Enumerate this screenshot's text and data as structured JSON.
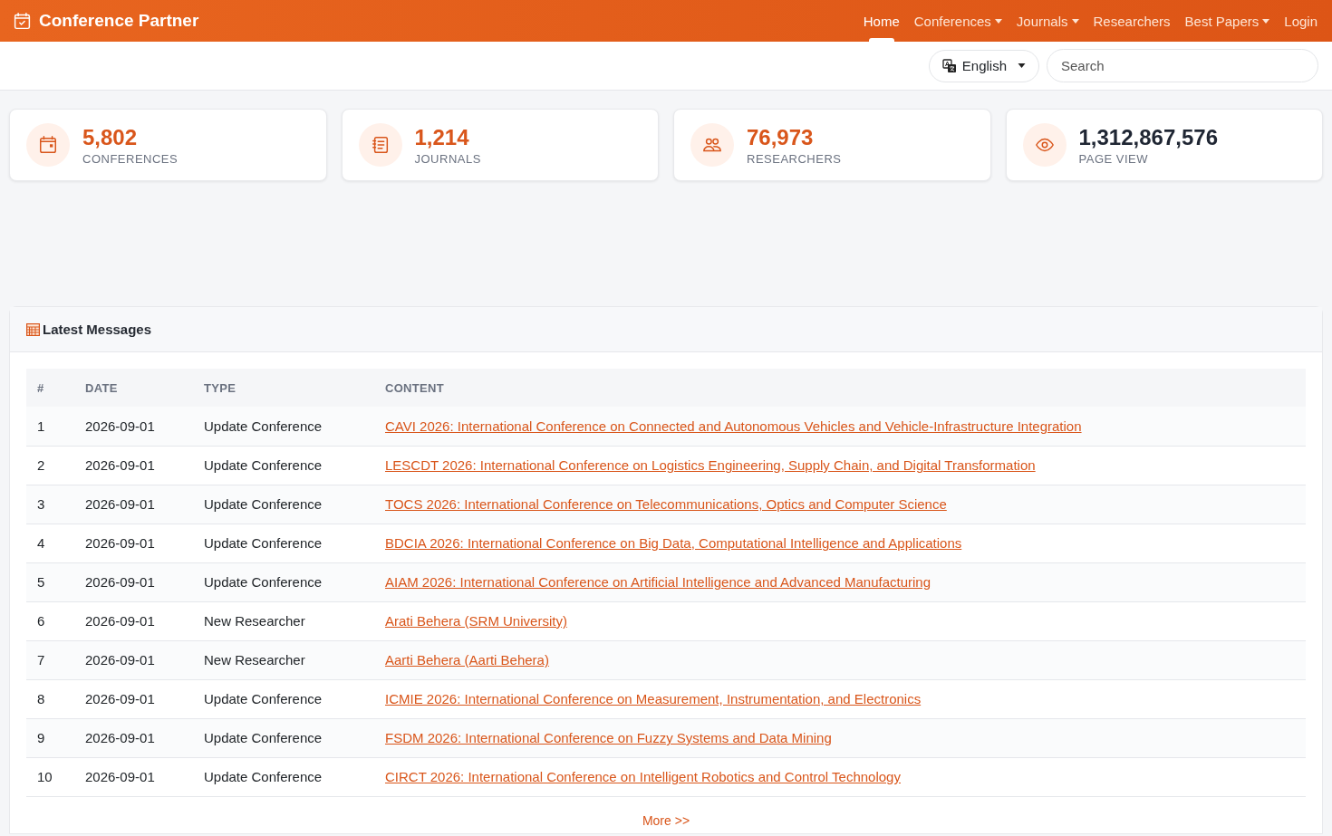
{
  "brand": {
    "title": "Conference Partner"
  },
  "nav": [
    {
      "label": "Home",
      "selected": true,
      "dropdown": false
    },
    {
      "label": "Conferences",
      "selected": false,
      "dropdown": true
    },
    {
      "label": "Journals",
      "selected": false,
      "dropdown": true
    },
    {
      "label": "Researchers",
      "selected": false,
      "dropdown": false
    },
    {
      "label": "Best Papers",
      "selected": false,
      "dropdown": true
    },
    {
      "label": "Login",
      "selected": false,
      "dropdown": false
    }
  ],
  "toolbar": {
    "language": "English",
    "search": {
      "placeholder": "Search"
    }
  },
  "stats": [
    {
      "kind": "calendar",
      "value": "5,802",
      "label": "CONFERENCES",
      "accent": true
    },
    {
      "kind": "journal",
      "value": "1,214",
      "label": "JOURNALS",
      "accent": true
    },
    {
      "kind": "people",
      "value": "76,973",
      "label": "RESEARCHERS",
      "accent": true
    },
    {
      "kind": "eye",
      "value": "1,312,867,576",
      "label": "PAGE VIEW",
      "accent": false
    }
  ],
  "messages": {
    "title": "Latest Messages",
    "columns": [
      "#",
      "DATE",
      "TYPE",
      "CONTENT"
    ],
    "rows": [
      {
        "index": "1",
        "date": "2026-09-01",
        "type": "Update Conference",
        "content": "CAVI 2026: International Conference on Connected and Autonomous Vehicles and Vehicle-Infrastructure Integration"
      },
      {
        "index": "2",
        "date": "2026-09-01",
        "type": "Update Conference",
        "content": "LESCDT 2026: International Conference on Logistics Engineering, Supply Chain, and Digital Transformation"
      },
      {
        "index": "3",
        "date": "2026-09-01",
        "type": "Update Conference",
        "content": "TOCS 2026: International Conference on Telecommunications, Optics and Computer Science"
      },
      {
        "index": "4",
        "date": "2026-09-01",
        "type": "Update Conference",
        "content": "BDCIA 2026: International Conference on Big Data, Computational Intelligence and Applications"
      },
      {
        "index": "5",
        "date": "2026-09-01",
        "type": "Update Conference",
        "content": "AIAM 2026: International Conference on Artificial Intelligence and Advanced Manufacturing"
      },
      {
        "index": "6",
        "date": "2026-09-01",
        "type": "New Researcher",
        "content": "Arati Behera (SRM University)"
      },
      {
        "index": "7",
        "date": "2026-09-01",
        "type": "New Researcher",
        "content": "Aarti Behera (Aarti Behera)"
      },
      {
        "index": "8",
        "date": "2026-09-01",
        "type": "Update Conference",
        "content": "ICMIE 2026: International Conference on Measurement, Instrumentation, and Electronics"
      },
      {
        "index": "9",
        "date": "2026-09-01",
        "type": "Update Conference",
        "content": "FSDM 2026: International Conference on Fuzzy Systems and Data Mining"
      },
      {
        "index": "10",
        "date": "2026-09-01",
        "type": "Update Conference",
        "content": "CIRCT 2026: International Conference on Intelligent Robotics and Control Technology"
      }
    ],
    "more": "More >>"
  }
}
